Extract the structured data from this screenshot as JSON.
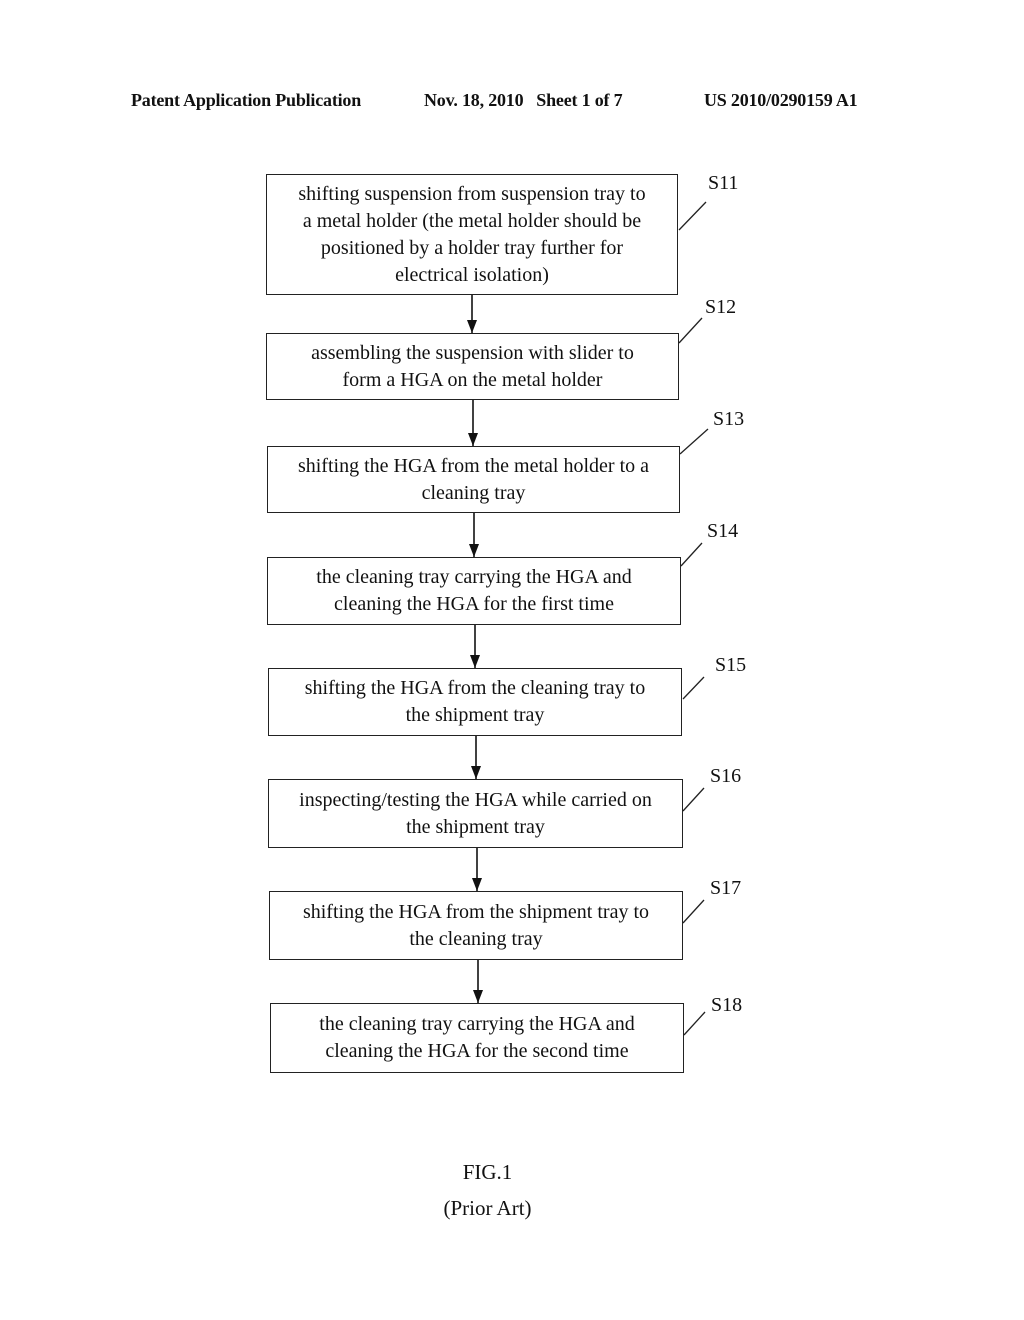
{
  "header": {
    "left": "Patent Application Publication",
    "middle": "Nov. 18, 2010   Sheet 1 of 7",
    "right": "US 2010/0290159 A1"
  },
  "steps": [
    {
      "id": "S11",
      "text": "shifting suspension from suspension tray to\na metal holder (the metal holder should be\npositioned by a holder tray further for\nelectrical isolation)"
    },
    {
      "id": "S12",
      "text": "assembling the suspension with slider to\nform a HGA on the metal holder"
    },
    {
      "id": "S13",
      "text": "shifting the HGA from the metal holder to a\ncleaning tray"
    },
    {
      "id": "S14",
      "text": "the cleaning tray carrying the HGA and\ncleaning the HGA for the first time"
    },
    {
      "id": "S15",
      "text": "shifting the HGA from the cleaning tray to\nthe shipment tray"
    },
    {
      "id": "S16",
      "text": "inspecting/testing the HGA while carried on\nthe shipment tray"
    },
    {
      "id": "S17",
      "text": "shifting the HGA from the shipment tray to\nthe cleaning tray"
    },
    {
      "id": "S18",
      "text": "the cleaning tray carrying the HGA and\ncleaning the HGA for the second time"
    }
  ],
  "figure": {
    "caption": "FIG.1",
    "subcaption": "(Prior Art)"
  }
}
